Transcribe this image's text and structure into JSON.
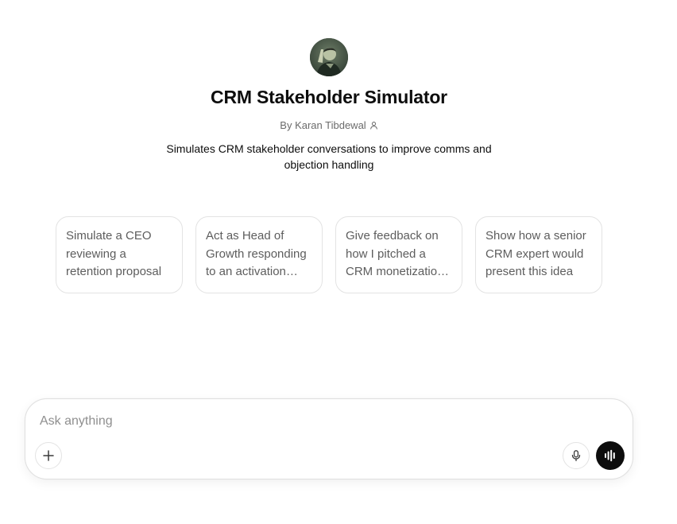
{
  "gpt": {
    "name": "CRM Stakeholder Simulator",
    "author": "By Karan Tibdewal",
    "description": "Simulates CRM stakeholder conversations to improve comms and objection handling"
  },
  "conversation_starters": [
    "Simulate a CEO reviewing a retention proposal",
    "Act as Head of Growth responding to an activation proposal",
    "Give feedback on how I pitched a CRM monetization idea",
    "Show how a senior CRM expert would present this idea"
  ],
  "composer": {
    "placeholder": "Ask anything",
    "value": ""
  },
  "icons": {
    "avatar": "portrait-avatar",
    "author_badge": "person-icon",
    "add": "plus-icon",
    "dictate": "microphone-icon",
    "voice": "voice-waveform-icon"
  },
  "colors": {
    "text_primary": "#0d0d0d",
    "text_secondary": "#6b6b6b",
    "starter_text": "#5d5d5d",
    "border": "#e3e3e3",
    "voice_button": "#0d0d0d"
  }
}
